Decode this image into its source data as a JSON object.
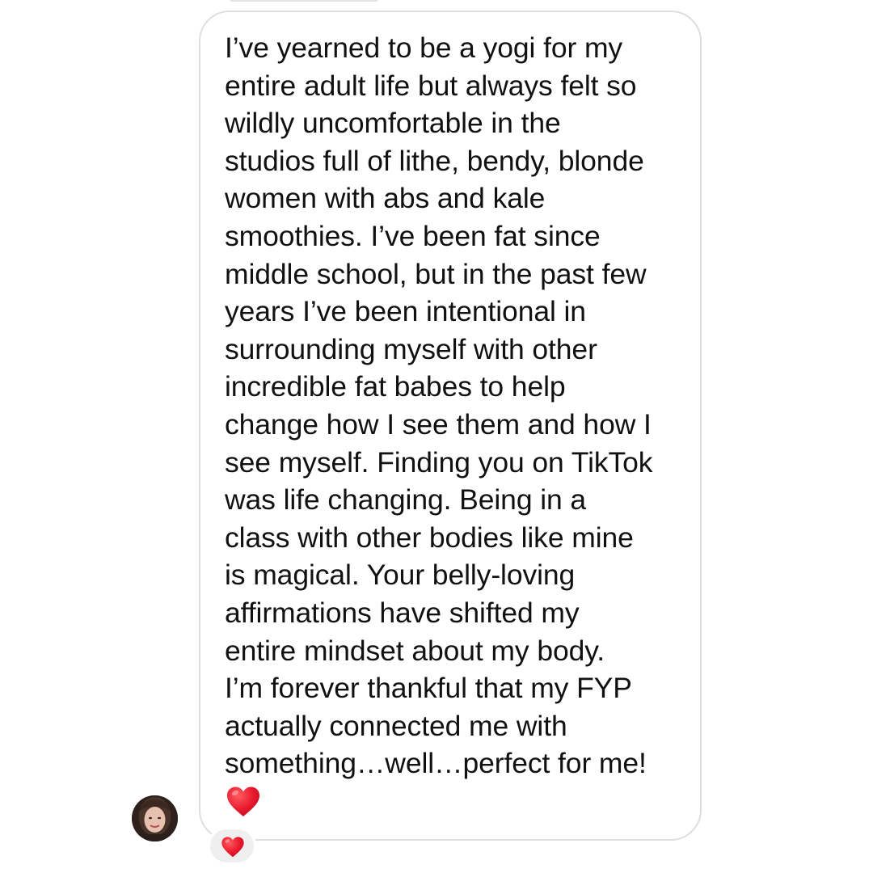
{
  "message": {
    "text": "I’ve yearned to be a yogi for my\nentire adult life but always felt so\nwildly uncomfortable in the\nstudios full of lithe, bendy, blonde\nwomen with abs and kale\nsmoothies. I’ve been fat since\nmiddle school, but in the past few\nyears I’ve been intentional in\nsurrounding myself with other\nincredible fat babes to help\nchange how I see them and how I\nsee myself. Finding you on TikTok\nwas life changing. Being in a\nclass with other bodies like mine\nis magical. Your belly-loving\naffirmations have shifted my\nentire mindset about my body.\nI’m forever thankful that my FYP\nactually connected me with\nsomething…well…perfect for me!",
    "inline_emoji": "red-heart-icon"
  },
  "reaction": {
    "emoji": "red-heart-icon"
  },
  "colors": {
    "bubble_border": "#dedede",
    "text": "#111111",
    "heart": "#e0172e",
    "reaction_bg": "#efefef"
  }
}
